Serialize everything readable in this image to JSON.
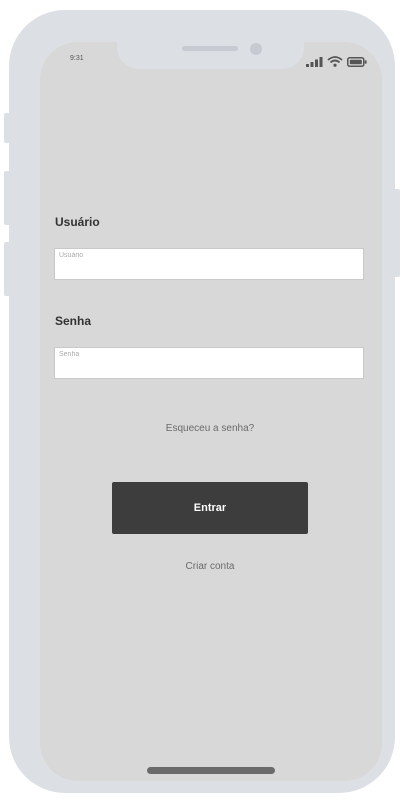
{
  "status_bar": {
    "time": "9:31",
    "icons": [
      "cellular-signal-icon",
      "wifi-icon",
      "battery-icon"
    ]
  },
  "form": {
    "username_label": "Usuário",
    "username_placeholder": "Usuário",
    "username_value": "",
    "password_label": "Senha",
    "password_placeholder": "Senha",
    "password_value": ""
  },
  "links": {
    "forgot_password": "Esqueceu a senha?",
    "create_account": "Criar conta"
  },
  "buttons": {
    "login_label": "Entrar"
  },
  "colors": {
    "screen_background": "#d8d8d8",
    "device_frame": "#dcdfe4",
    "primary_button": "#3d3d3d",
    "link_text": "#6b6b6b"
  }
}
